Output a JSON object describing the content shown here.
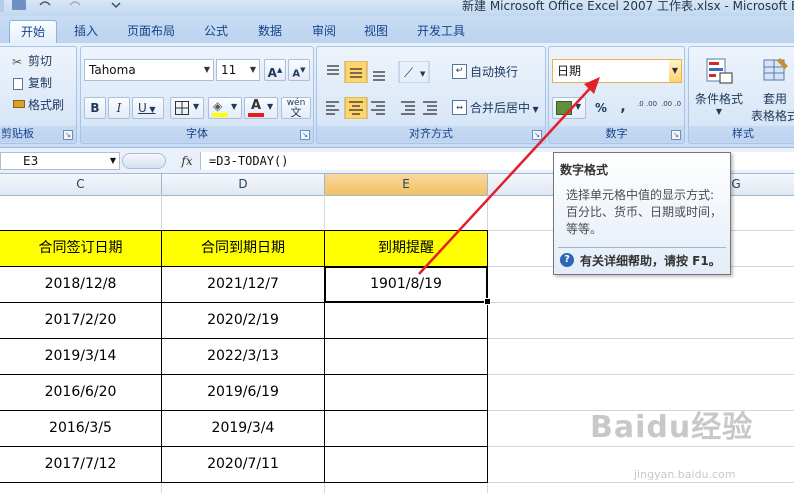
{
  "window": {
    "title": "新建 Microsoft Office Excel 2007 工作表.xlsx - Microsoft E"
  },
  "ribbon_tabs": [
    "开始",
    "插入",
    "页面布局",
    "公式",
    "数据",
    "审阅",
    "视图",
    "开发工具"
  ],
  "clipboard": {
    "cut": "剪切",
    "copy": "复制",
    "format_painter": "格式刷",
    "group_label": "剪贴板"
  },
  "font": {
    "name": "Tahoma",
    "size": "11",
    "grow": "A",
    "shrink": "A",
    "bold": "B",
    "italic": "I",
    "underline": "U",
    "font_color_glyph": "A",
    "phonetic": "wén",
    "group_label": "字体"
  },
  "alignment": {
    "wrap_text": "自动换行",
    "merge_center": "合并后居中",
    "group_label": "对齐方式"
  },
  "number": {
    "format": "日期",
    "percent": "%",
    "comma": ",",
    "inc_decimal": ".0 .00",
    "dec_decimal": ".00 .0",
    "group_label": "数字"
  },
  "styles": {
    "conditional": "条件格式",
    "table_format_1": "套用",
    "table_format_2": "表格格式",
    "group_label": "样式"
  },
  "formula_bar": {
    "name_box": "E3",
    "fx": "fx",
    "formula": "=D3-TODAY()"
  },
  "columns": [
    {
      "label": "C",
      "selected": false
    },
    {
      "label": "D",
      "selected": false
    },
    {
      "label": "E",
      "selected": true
    },
    {
      "label": "G",
      "selected": false
    }
  ],
  "table": {
    "headers": [
      "合同签订日期",
      "合同到期日期",
      "到期提醒"
    ],
    "rows": [
      [
        "2018/12/8",
        "2021/12/7",
        "1901/8/19"
      ],
      [
        "2017/2/20",
        "2020/2/19",
        ""
      ],
      [
        "2019/3/14",
        "2022/3/13",
        ""
      ],
      [
        "2016/6/20",
        "2019/6/19",
        ""
      ],
      [
        "2016/3/5",
        "2019/3/4",
        ""
      ],
      [
        "2017/7/12",
        "2020/7/11",
        ""
      ]
    ]
  },
  "tooltip": {
    "title": "数字格式",
    "body": "选择单元格中值的显示方式: 百分比、货币、日期或时间，等等。",
    "help": "有关详细帮助，请按 F1。"
  },
  "watermark": {
    "brand": "Baidu经验",
    "url": "jingyan.baidu.com"
  },
  "colors": {
    "header_fill": "#ffff00",
    "arrow": "#e0202a",
    "selected_col": "#f1c15f"
  }
}
